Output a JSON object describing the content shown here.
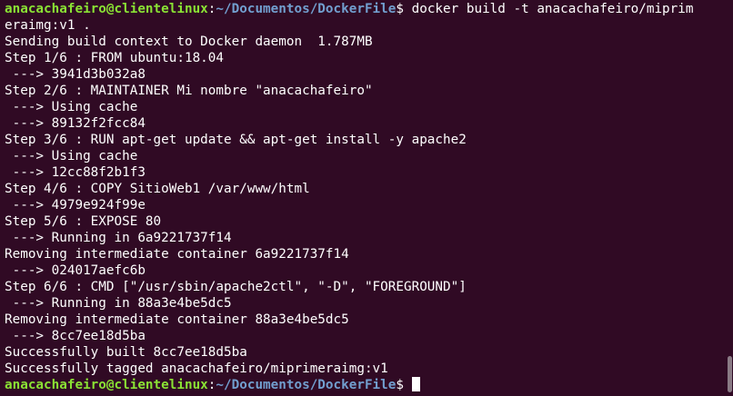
{
  "terminal": {
    "prompt": {
      "user_host": "anacachafeiro@clientelinux",
      "colon": ":",
      "path": "~/Documentos/DockerFile",
      "symbol": "$ "
    },
    "command_part1": "docker build -t anacachafeiro/miprim",
    "command_part2": "eraimg:v1 .",
    "output": [
      "Sending build context to Docker daemon  1.787MB",
      "Step 1/6 : FROM ubuntu:18.04",
      " ---> 3941d3b032a8",
      "Step 2/6 : MAINTAINER Mi nombre \"anacachafeiro\"",
      " ---> Using cache",
      " ---> 89132f2fcc84",
      "Step 3/6 : RUN apt-get update && apt-get install -y apache2",
      " ---> Using cache",
      " ---> 12cc88f2b1f3",
      "Step 4/6 : COPY SitioWeb1 /var/www/html",
      " ---> 4979e924f99e",
      "Step 5/6 : EXPOSE 80",
      " ---> Running in 6a9221737f14",
      "Removing intermediate container 6a9221737f14",
      " ---> 024017aefc6b",
      "Step 6/6 : CMD [\"/usr/sbin/apache2ctl\", \"-D\", \"FOREGROUND\"]",
      " ---> Running in 88a3e4be5dc5",
      "Removing intermediate container 88a3e4be5dc5",
      " ---> 8cc7ee18d5ba",
      "Successfully built 8cc7ee18d5ba",
      "Successfully tagged anacachafeiro/miprimeraimg:v1"
    ]
  },
  "colors": {
    "background": "#300a24",
    "user_host": "#8ae234",
    "path": "#729fcf",
    "text": "#ffffff"
  }
}
